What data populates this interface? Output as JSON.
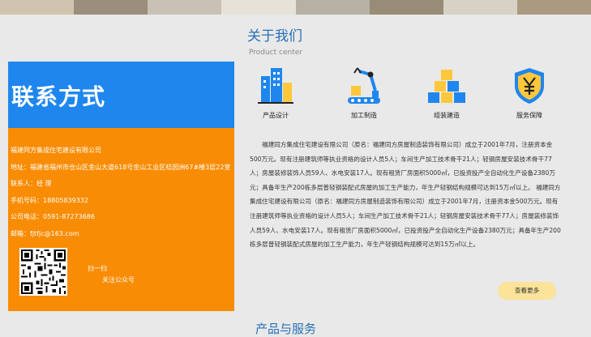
{
  "sidebar": {
    "title": "联系方式",
    "company": "福建同方集成住宅建设有限公司",
    "address": "地址：福建省福州市仓山区金山大道618号金山工业区桔园洲67#楼3层22室",
    "contact": "联系人：经  理",
    "phone": "手机号码：18805839332",
    "tel": "公司电话：0591-87273686",
    "email": "邮箱：fjtfjc@163.com",
    "qr_line1": "扫一扫",
    "qr_line2": "关注公众号"
  },
  "about": {
    "heading": "关于我们",
    "subheading": "Product center",
    "features": [
      {
        "label": "产品设计",
        "icon": "building-chart-icon"
      },
      {
        "label": "加工制造",
        "icon": "robot-arm-icon"
      },
      {
        "label": "组装建造",
        "icon": "stacked-blocks-icon"
      },
      {
        "label": "服务保障",
        "icon": "yen-shield-icon"
      }
    ],
    "body": "福建同方集成住宅建设有限公司（原名：福建同方房屋制造装饰有限公司）成立于2001年7月，注册资本金500万元。现有注册建筑师等执业资格的设计人员5人；车间生产加工技术骨干21人；轻钢房屋安装技术骨干77人；房屋装修装饰人员59人、水电安装17人。现有租赁厂房面积5000㎡，已投资投产全自动化生产设备2380万元；具备年生产200栋多层普轻钢装配式房屋的加工生产能力，年生产轻钢结构规模可达到15万㎡以上。 福建同方集成住宅建设有限公司（原名：福建同方房屋制造装饰有限公司）成立于2001年7月，注册资本金500万元。现有注册建筑师等执业资格的设计人员5人；车间生产加工技术骨干21人；轻钢房屋安装技术骨干77人；房屋装修装饰人员59人、水电安装17人。现有租赁厂房面积5000㎡，已投资投产全自动化生产设备2380万元；具备年生产200栋多层普轻钢装配式房屋的加工生产能力，年生产轻钢结构规模可达到15万㎡以上。",
    "more_button": "查看更多"
  },
  "products": {
    "heading": "产品与服务"
  },
  "colors": {
    "blue": "#1f86ee",
    "orange": "#f98c05",
    "heading_blue": "#2770b5",
    "button_yellow": "#fbe399"
  }
}
